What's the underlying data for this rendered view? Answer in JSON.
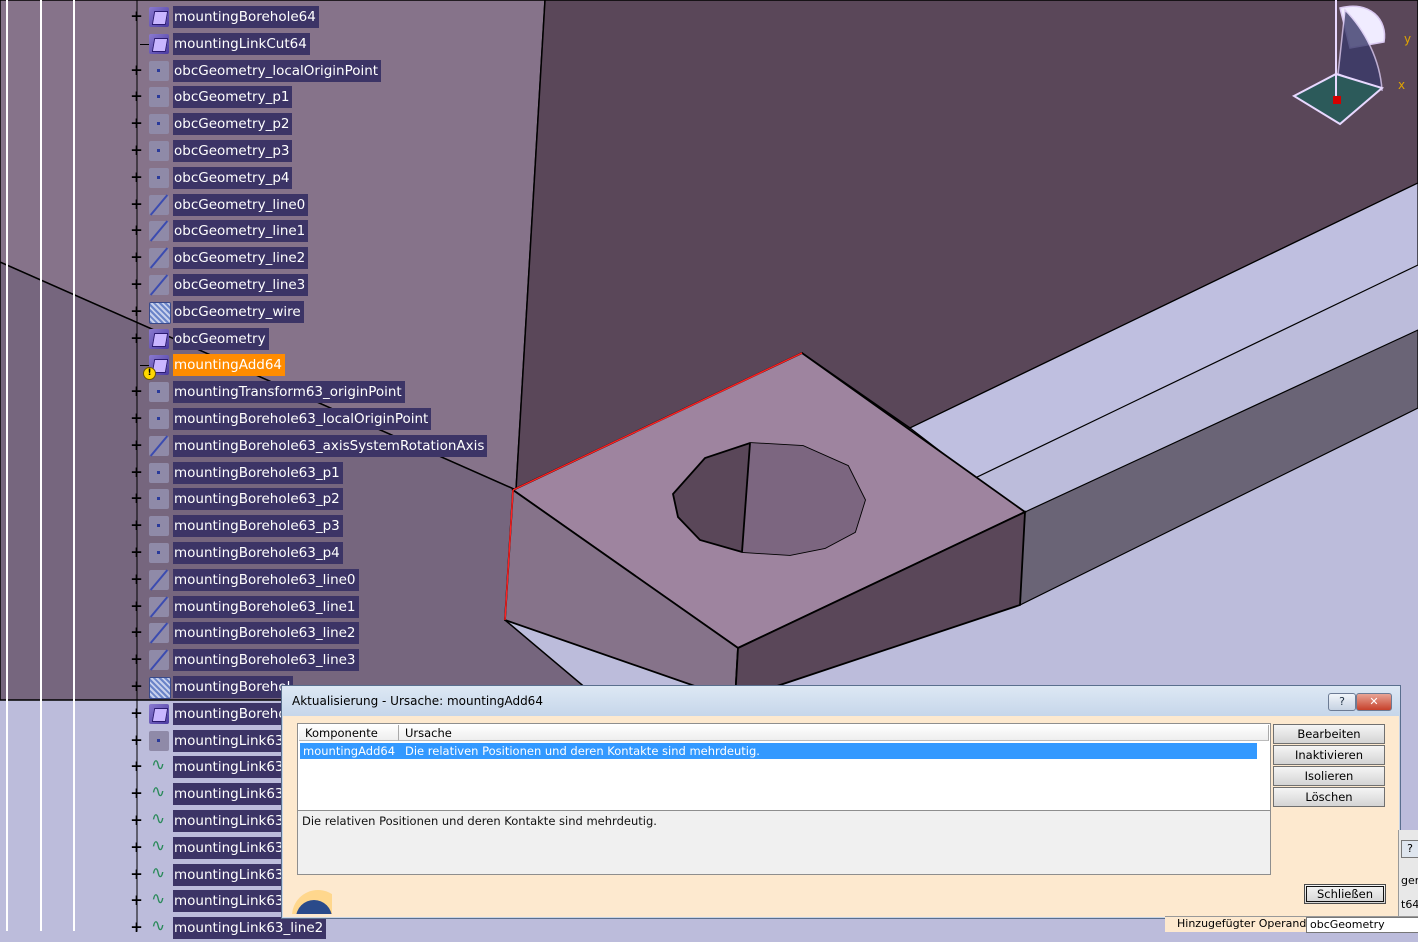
{
  "tree": {
    "items": [
      {
        "label": "mountingBorehole64",
        "icon": "borehole-icon",
        "expand": true
      },
      {
        "label": "mountingLinkCut64",
        "icon": "link-cut-icon",
        "expand": false
      },
      {
        "label": "obcGeometry_localOriginPoint",
        "icon": "point-icon",
        "expand": true
      },
      {
        "label": "obcGeometry_p1",
        "icon": "point-icon",
        "expand": true
      },
      {
        "label": "obcGeometry_p2",
        "icon": "point-icon",
        "expand": true
      },
      {
        "label": "obcGeometry_p3",
        "icon": "point-icon",
        "expand": true
      },
      {
        "label": "obcGeometry_p4",
        "icon": "point-icon",
        "expand": true
      },
      {
        "label": "obcGeometry_line0",
        "icon": "line-icon",
        "expand": true
      },
      {
        "label": "obcGeometry_line1",
        "icon": "line-icon",
        "expand": true
      },
      {
        "label": "obcGeometry_line2",
        "icon": "line-icon",
        "expand": true
      },
      {
        "label": "obcGeometry_line3",
        "icon": "line-icon",
        "expand": true
      },
      {
        "label": "obcGeometry_wire",
        "icon": "wire-icon",
        "expand": true
      },
      {
        "label": "obcGeometry",
        "icon": "body-icon",
        "expand": true
      },
      {
        "label": "mountingAdd64",
        "icon": "body-warning-icon",
        "expand": false,
        "selected": true
      },
      {
        "label": "mountingTransform63_originPoint",
        "icon": "point-icon",
        "expand": true
      },
      {
        "label": "mountingBorehole63_localOriginPoint",
        "icon": "point-icon",
        "expand": true
      },
      {
        "label": "mountingBorehole63_axisSystemRotationAxis",
        "icon": "line-icon",
        "expand": true
      },
      {
        "label": "mountingBorehole63_p1",
        "icon": "point-icon",
        "expand": true
      },
      {
        "label": "mountingBorehole63_p2",
        "icon": "point-icon",
        "expand": true
      },
      {
        "label": "mountingBorehole63_p3",
        "icon": "point-icon",
        "expand": true
      },
      {
        "label": "mountingBorehole63_p4",
        "icon": "point-icon",
        "expand": true
      },
      {
        "label": "mountingBorehole63_line0",
        "icon": "line-icon",
        "expand": true
      },
      {
        "label": "mountingBorehole63_line1",
        "icon": "line-icon",
        "expand": true
      },
      {
        "label": "mountingBorehole63_line2",
        "icon": "line-icon",
        "expand": true
      },
      {
        "label": "mountingBorehole63_line3",
        "icon": "line-icon",
        "expand": true
      },
      {
        "label": "mountingBorehol",
        "icon": "wire-icon",
        "expand": true
      },
      {
        "label": "mountingBoreho",
        "icon": "borehole-icon",
        "expand": true
      },
      {
        "label": "mountingLink63_",
        "icon": "point-icon",
        "expand": true
      },
      {
        "label": "mountingLink63_",
        "icon": "link-icon",
        "expand": true
      },
      {
        "label": "mountingLink63_",
        "icon": "link-icon",
        "expand": true
      },
      {
        "label": "mountingLink63_",
        "icon": "link-icon",
        "expand": true
      },
      {
        "label": "mountingLink63_",
        "icon": "link-icon",
        "expand": true
      },
      {
        "label": "mountingLink63_",
        "icon": "link-icon",
        "expand": true
      },
      {
        "label": "mountingLink63_",
        "icon": "link-icon",
        "expand": true
      },
      {
        "label": "mountingLink63_line2",
        "icon": "link-icon",
        "expand": true
      }
    ]
  },
  "compass": {
    "y_label": "y",
    "x_label": "x"
  },
  "dialog": {
    "title": "Aktualisierung - Ursache: mountingAdd64",
    "help_label": "?",
    "close_x_label": "✕",
    "columns": {
      "component": "Komponente",
      "cause": "Ursache"
    },
    "rows": [
      {
        "component": "mountingAdd64",
        "cause": "Die relativen Positionen und deren Kontakte sind mehrdeutig."
      }
    ],
    "description": "Die relativen Positionen und deren Kontakte sind mehrdeutig.",
    "buttons": {
      "edit": "Bearbeiten",
      "deactivate": "Inaktivieren",
      "isolate": "Isolieren",
      "delete": "Löschen",
      "close": "Schließen"
    }
  },
  "background_panel": {
    "help_label": "?",
    "frag1": "gen",
    "frag2": "t64",
    "operand_label": "Hinzugefügter Operand:",
    "operand_value": "obcGeometry"
  },
  "colors": {
    "viewport_bg": "#bcbcdb",
    "selection": "#ff8c00",
    "row_highlight": "#3399ff",
    "dialog_bg": "#fde9cf"
  }
}
